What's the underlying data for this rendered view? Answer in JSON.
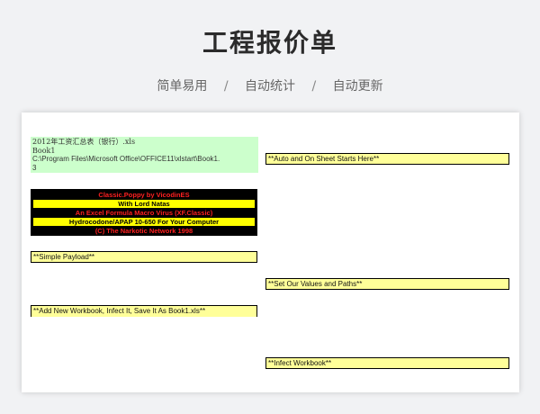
{
  "header": {
    "title": "工程报价单",
    "subtitle": [
      "简单易用",
      "/",
      "自动统计",
      "/",
      "自动更新"
    ]
  },
  "sheet": {
    "green_cell": {
      "line1": "2012年工资汇总表（银行）.xls",
      "line2": "Book1",
      "line3": "C:\\Program Files\\Microsoft Office\\OFFICE11\\xlstart\\Book1.",
      "line4": "3"
    },
    "banner": [
      "Classic.Poppy by VicodinES",
      "With Lord Natas",
      "An Excel Formula Macro Virus (XF.Classic)",
      "Hydrocodone/APAP 10-650 For Your Computer",
      "(C) The Narkotic Network 1998"
    ],
    "cells": {
      "simple_payload": "**Simple Payload**",
      "add_new_workbook": "**Add New Workbook, Infect It, Save It As Book1.xls**",
      "auto_on_sheet": "**Auto and On Sheet Starts Here**",
      "set_values": "**Set Our Values and Paths**",
      "infect_workbook": "**Infect Workbook**"
    }
  }
}
